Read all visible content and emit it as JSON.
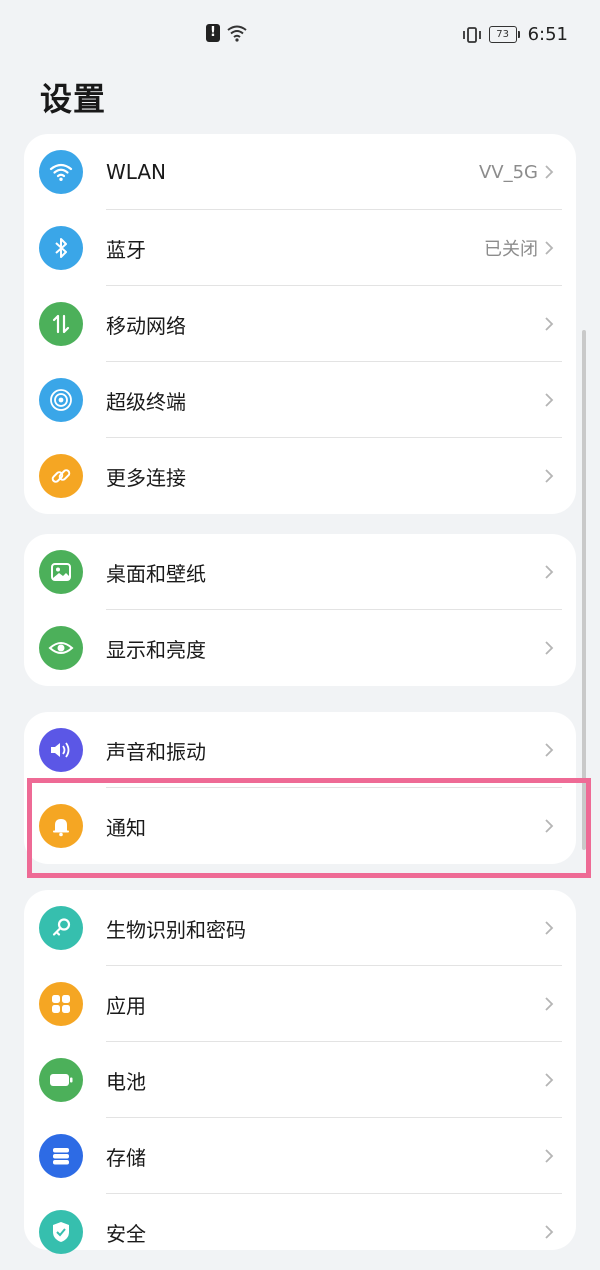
{
  "status_bar": {
    "time": "6:51",
    "battery": "73"
  },
  "title": "设置",
  "groups": [
    {
      "items": [
        {
          "label": "WLAN",
          "value": "VV_5G",
          "icon": "wifi-icon",
          "color": "#3aa6e8"
        },
        {
          "label": "蓝牙",
          "value": "已关闭",
          "icon": "bluetooth-icon",
          "color": "#3aa6e8"
        },
        {
          "label": "移动网络",
          "value": "",
          "icon": "mobile-data-icon",
          "color": "#4cb05a"
        },
        {
          "label": "超级终端",
          "value": "",
          "icon": "super-device-icon",
          "color": "#3aa6e8"
        },
        {
          "label": "更多连接",
          "value": "",
          "icon": "link-icon",
          "color": "#f5a623"
        }
      ]
    },
    {
      "items": [
        {
          "label": "桌面和壁纸",
          "value": "",
          "icon": "wallpaper-icon",
          "color": "#4cb05a"
        },
        {
          "label": "显示和亮度",
          "value": "",
          "icon": "eye-icon",
          "color": "#4cb05a"
        }
      ]
    },
    {
      "items": [
        {
          "label": "声音和振动",
          "value": "",
          "icon": "sound-icon",
          "color": "#5b57e6"
        },
        {
          "label": "通知",
          "value": "",
          "icon": "bell-icon",
          "color": "#f5a623"
        }
      ]
    },
    {
      "items": [
        {
          "label": "生物识别和密码",
          "value": "",
          "icon": "key-icon",
          "color": "#36bfae"
        },
        {
          "label": "应用",
          "value": "",
          "icon": "apps-icon",
          "color": "#f5a623"
        },
        {
          "label": "电池",
          "value": "",
          "icon": "battery-icon",
          "color": "#4cb05a"
        },
        {
          "label": "存储",
          "value": "",
          "icon": "storage-icon",
          "color": "#2d6be5"
        },
        {
          "label": "安全",
          "value": "",
          "icon": "shield-icon",
          "color": "#36bfae"
        }
      ]
    }
  ]
}
